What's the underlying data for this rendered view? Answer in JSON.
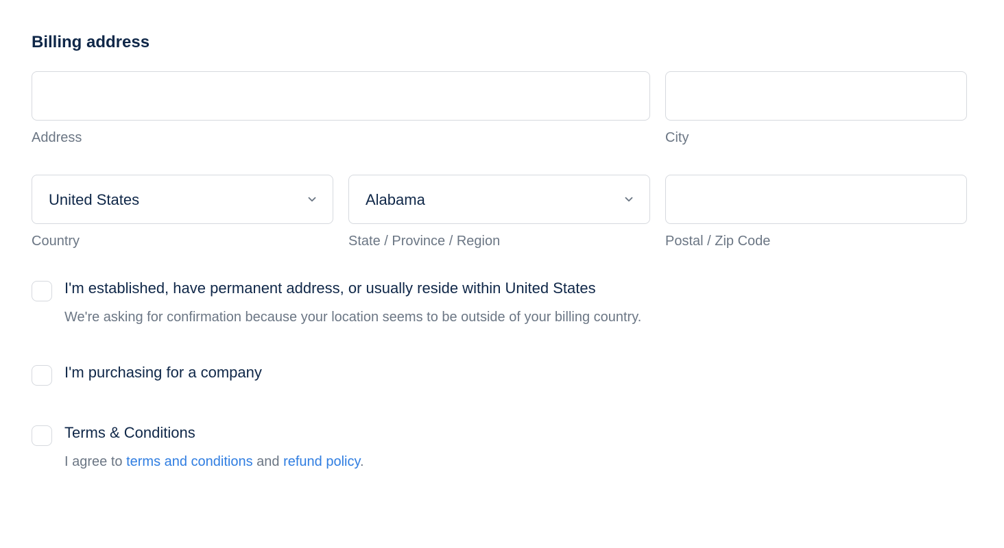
{
  "title": "Billing address",
  "fields": {
    "address": {
      "label": "Address",
      "value": ""
    },
    "city": {
      "label": "City",
      "value": ""
    },
    "country": {
      "label": "Country",
      "value": "United States"
    },
    "state": {
      "label": "State / Province / Region",
      "value": "Alabama"
    },
    "postal": {
      "label": "Postal / Zip Code",
      "value": ""
    }
  },
  "checks": {
    "residency": {
      "label": "I'm established, have permanent address, or usually reside within United States",
      "sub": "We're asking for confirmation because your location seems to be outside of your billing country."
    },
    "company": {
      "label": "I'm purchasing for a company"
    },
    "terms": {
      "label": "Terms & Conditions",
      "sub_prefix": "I agree to ",
      "link1": "terms and conditions",
      "sub_mid": " and ",
      "link2": "refund policy",
      "sub_suffix": "."
    }
  }
}
